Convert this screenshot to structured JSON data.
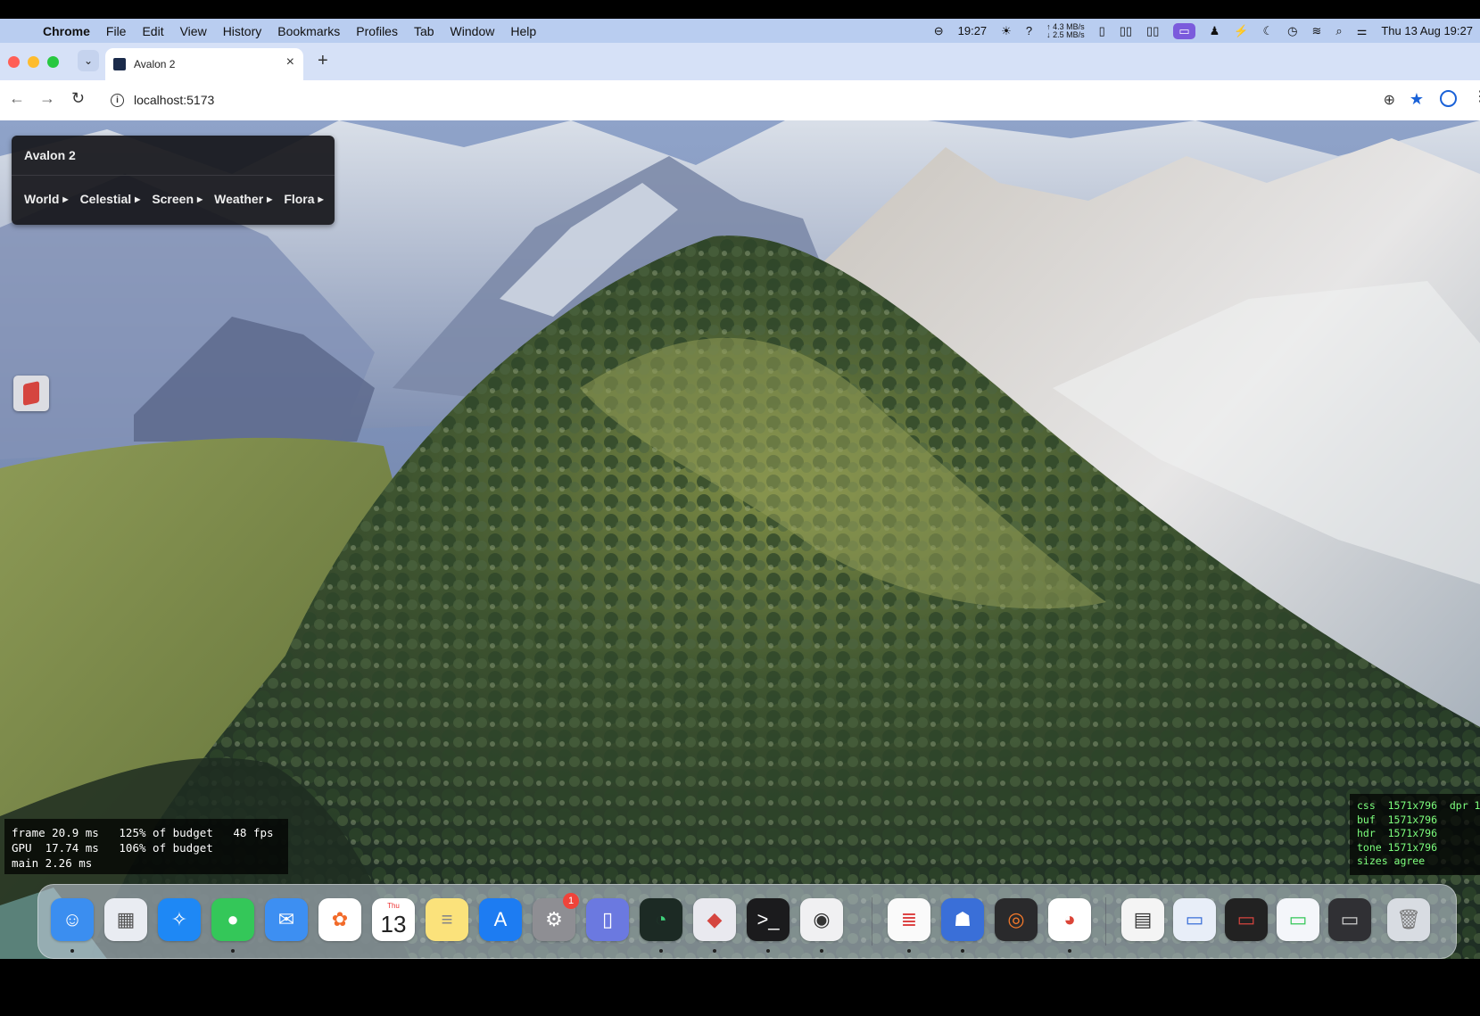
{
  "menubar": {
    "app_name": "Chrome",
    "items": [
      "File",
      "Edit",
      "View",
      "History",
      "Bookmarks",
      "Profiles",
      "Tab",
      "Window",
      "Help"
    ],
    "clock": "19:27",
    "net_up": "↑ 4.3 MB/s",
    "net_down": "↓ 2.5 MB/s",
    "date_time": "Thu 13 Aug  19:27",
    "question": "?"
  },
  "browser": {
    "tab_title": "Avalon 2",
    "tab_close": "×",
    "new_tab": "+",
    "url": "localhost:5173",
    "back": "←",
    "forward": "→",
    "reload": "↻"
  },
  "hud": {
    "title": "Avalon 2",
    "menu": [
      {
        "label": "World"
      },
      {
        "label": "Celestial"
      },
      {
        "label": "Screen"
      },
      {
        "label": "Weather"
      },
      {
        "label": "Flora"
      }
    ]
  },
  "perf": {
    "frame": "frame 20.9 ms   125% of budget   48 fps",
    "gpu": "GPU  17.74 ms   106% of budget",
    "main": "main 2.26 ms"
  },
  "sizes": {
    "css": "css  1571x796  dpr 1",
    "buf": "buf  1571x796",
    "hdr": "hdr  1571x796",
    "tone": "tone 1571x796",
    "agree": "sizes agree"
  },
  "dock": {
    "settings_badge": "1",
    "calendar_dow": "Thu",
    "calendar_day": "13"
  },
  "colors": {
    "menubar_bg": "#b9cdf0",
    "tabstrip_bg": "#d6e1f7",
    "hud_bg": "#16161a",
    "size_text": "#7dff7d",
    "accent_blue": "#1a62d8"
  }
}
